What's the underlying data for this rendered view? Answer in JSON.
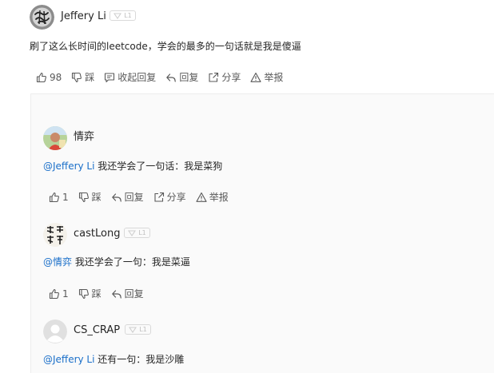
{
  "top_comment": {
    "author": "Jeffery Li",
    "level": "L1",
    "text": "刷了这么长时间的leetcode，学会的最多的一句话就是我是傻逼",
    "actions": {
      "like_count": "98",
      "dislike": "踩",
      "collapse": "收起回复",
      "reply": "回复",
      "share": "分享",
      "report": "举报"
    }
  },
  "replies": [
    {
      "author": "情弈",
      "level": "",
      "mention": "@Jeffery Li",
      "text": " 我还学会了一句话：我是菜狗",
      "actions": {
        "like_count": "1",
        "dislike": "踩",
        "reply": "回复",
        "share": "分享",
        "report": "举报"
      }
    },
    {
      "author": "castLong",
      "level": "L1",
      "mention": "@情弈",
      "text": " 我还学会了一句：我是菜逼",
      "actions": {
        "like_count": "1",
        "dislike": "踩",
        "reply": "回复"
      }
    },
    {
      "author": "CS_CRAP",
      "level": "L1",
      "mention": "@Jeffery Li",
      "text": " 还有一句：我是沙雕"
    }
  ],
  "icons": [
    "like-icon",
    "dislike-icon",
    "comment-icon",
    "reply-icon",
    "share-icon",
    "report-icon",
    "level-badge-icon"
  ],
  "colors": {
    "mention": "#1a6fc9",
    "text": "#262626",
    "muted": "#595959",
    "badge": "#d9d9d9"
  }
}
